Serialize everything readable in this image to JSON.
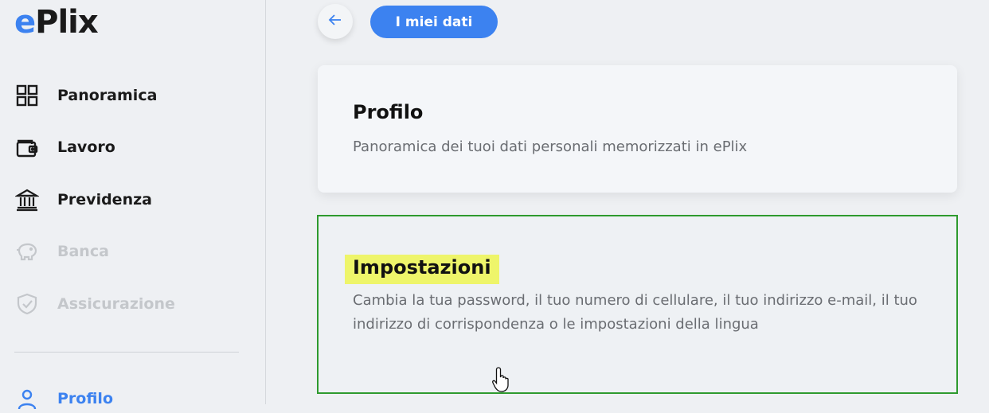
{
  "app": {
    "logo_e": "e",
    "logo_rest": "Plix"
  },
  "sidebar": {
    "items": [
      {
        "label": "Panoramica",
        "icon": "grid-icon",
        "state": "normal"
      },
      {
        "label": "Lavoro",
        "icon": "wallet-icon",
        "state": "normal"
      },
      {
        "label": "Previdenza",
        "icon": "bank-icon",
        "state": "normal"
      },
      {
        "label": "Banca",
        "icon": "piggy-bank-icon",
        "state": "disabled"
      },
      {
        "label": "Assicurazione",
        "icon": "shield-check-icon",
        "state": "disabled"
      },
      {
        "label": "Profilo",
        "icon": "user-icon",
        "state": "active"
      }
    ]
  },
  "header": {
    "back_icon": "arrow-left-icon",
    "title_button": "I miei dati"
  },
  "cards": [
    {
      "title": "Profilo",
      "description": "Panoramica dei tuoi dati personali memorizzati in ePlix"
    },
    {
      "title": "Impostazioni",
      "description": "Cambia la tua password, il tuo numero di cellulare, il tuo indirizzo e-mail, il tuo indirizzo di corrispondenza o le impostazioni della lingua"
    }
  ],
  "colors": {
    "accent": "#3c82f0",
    "highlight": "#eef56a",
    "selection_border": "#2e9a2e"
  }
}
